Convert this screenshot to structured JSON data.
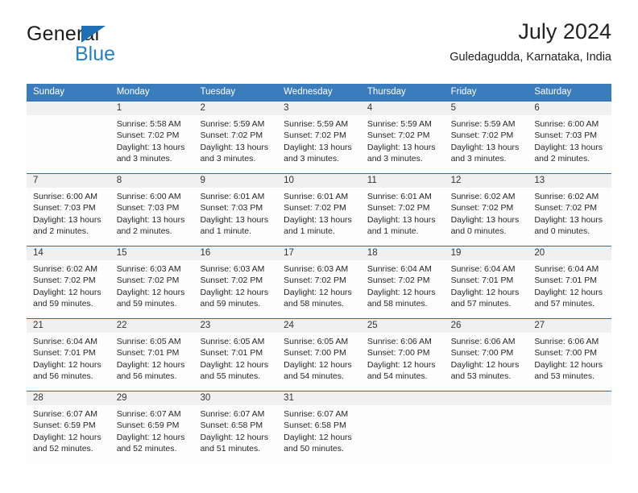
{
  "brand": {
    "name_top": "General",
    "name_bottom": "Blue",
    "accent_color": "#2581c4"
  },
  "header": {
    "title": "July 2024",
    "subtitle": "Guledagudda, Karnataka, India"
  },
  "theme": {
    "header_blue": "#3b7cbd",
    "row_rule_blue": "#2e6da4",
    "daynum_band": "#f0f0f0"
  },
  "weekdays": [
    "Sunday",
    "Monday",
    "Tuesday",
    "Wednesday",
    "Thursday",
    "Friday",
    "Saturday"
  ],
  "weeks": [
    [
      {
        "day": "",
        "sunrise": "",
        "sunset": "",
        "daylight1": "",
        "daylight2": ""
      },
      {
        "day": "1",
        "sunrise": "Sunrise: 5:58 AM",
        "sunset": "Sunset: 7:02 PM",
        "daylight1": "Daylight: 13 hours",
        "daylight2": "and 3 minutes."
      },
      {
        "day": "2",
        "sunrise": "Sunrise: 5:59 AM",
        "sunset": "Sunset: 7:02 PM",
        "daylight1": "Daylight: 13 hours",
        "daylight2": "and 3 minutes."
      },
      {
        "day": "3",
        "sunrise": "Sunrise: 5:59 AM",
        "sunset": "Sunset: 7:02 PM",
        "daylight1": "Daylight: 13 hours",
        "daylight2": "and 3 minutes."
      },
      {
        "day": "4",
        "sunrise": "Sunrise: 5:59 AM",
        "sunset": "Sunset: 7:02 PM",
        "daylight1": "Daylight: 13 hours",
        "daylight2": "and 3 minutes."
      },
      {
        "day": "5",
        "sunrise": "Sunrise: 5:59 AM",
        "sunset": "Sunset: 7:02 PM",
        "daylight1": "Daylight: 13 hours",
        "daylight2": "and 3 minutes."
      },
      {
        "day": "6",
        "sunrise": "Sunrise: 6:00 AM",
        "sunset": "Sunset: 7:03 PM",
        "daylight1": "Daylight: 13 hours",
        "daylight2": "and 2 minutes."
      }
    ],
    [
      {
        "day": "7",
        "sunrise": "Sunrise: 6:00 AM",
        "sunset": "Sunset: 7:03 PM",
        "daylight1": "Daylight: 13 hours",
        "daylight2": "and 2 minutes."
      },
      {
        "day": "8",
        "sunrise": "Sunrise: 6:00 AM",
        "sunset": "Sunset: 7:03 PM",
        "daylight1": "Daylight: 13 hours",
        "daylight2": "and 2 minutes."
      },
      {
        "day": "9",
        "sunrise": "Sunrise: 6:01 AM",
        "sunset": "Sunset: 7:03 PM",
        "daylight1": "Daylight: 13 hours",
        "daylight2": "and 1 minute."
      },
      {
        "day": "10",
        "sunrise": "Sunrise: 6:01 AM",
        "sunset": "Sunset: 7:02 PM",
        "daylight1": "Daylight: 13 hours",
        "daylight2": "and 1 minute."
      },
      {
        "day": "11",
        "sunrise": "Sunrise: 6:01 AM",
        "sunset": "Sunset: 7:02 PM",
        "daylight1": "Daylight: 13 hours",
        "daylight2": "and 1 minute."
      },
      {
        "day": "12",
        "sunrise": "Sunrise: 6:02 AM",
        "sunset": "Sunset: 7:02 PM",
        "daylight1": "Daylight: 13 hours",
        "daylight2": "and 0 minutes."
      },
      {
        "day": "13",
        "sunrise": "Sunrise: 6:02 AM",
        "sunset": "Sunset: 7:02 PM",
        "daylight1": "Daylight: 13 hours",
        "daylight2": "and 0 minutes."
      }
    ],
    [
      {
        "day": "14",
        "sunrise": "Sunrise: 6:02 AM",
        "sunset": "Sunset: 7:02 PM",
        "daylight1": "Daylight: 12 hours",
        "daylight2": "and 59 minutes."
      },
      {
        "day": "15",
        "sunrise": "Sunrise: 6:03 AM",
        "sunset": "Sunset: 7:02 PM",
        "daylight1": "Daylight: 12 hours",
        "daylight2": "and 59 minutes."
      },
      {
        "day": "16",
        "sunrise": "Sunrise: 6:03 AM",
        "sunset": "Sunset: 7:02 PM",
        "daylight1": "Daylight: 12 hours",
        "daylight2": "and 59 minutes."
      },
      {
        "day": "17",
        "sunrise": "Sunrise: 6:03 AM",
        "sunset": "Sunset: 7:02 PM",
        "daylight1": "Daylight: 12 hours",
        "daylight2": "and 58 minutes."
      },
      {
        "day": "18",
        "sunrise": "Sunrise: 6:04 AM",
        "sunset": "Sunset: 7:02 PM",
        "daylight1": "Daylight: 12 hours",
        "daylight2": "and 58 minutes."
      },
      {
        "day": "19",
        "sunrise": "Sunrise: 6:04 AM",
        "sunset": "Sunset: 7:01 PM",
        "daylight1": "Daylight: 12 hours",
        "daylight2": "and 57 minutes."
      },
      {
        "day": "20",
        "sunrise": "Sunrise: 6:04 AM",
        "sunset": "Sunset: 7:01 PM",
        "daylight1": "Daylight: 12 hours",
        "daylight2": "and 57 minutes."
      }
    ],
    [
      {
        "day": "21",
        "sunrise": "Sunrise: 6:04 AM",
        "sunset": "Sunset: 7:01 PM",
        "daylight1": "Daylight: 12 hours",
        "daylight2": "and 56 minutes."
      },
      {
        "day": "22",
        "sunrise": "Sunrise: 6:05 AM",
        "sunset": "Sunset: 7:01 PM",
        "daylight1": "Daylight: 12 hours",
        "daylight2": "and 56 minutes."
      },
      {
        "day": "23",
        "sunrise": "Sunrise: 6:05 AM",
        "sunset": "Sunset: 7:01 PM",
        "daylight1": "Daylight: 12 hours",
        "daylight2": "and 55 minutes."
      },
      {
        "day": "24",
        "sunrise": "Sunrise: 6:05 AM",
        "sunset": "Sunset: 7:00 PM",
        "daylight1": "Daylight: 12 hours",
        "daylight2": "and 54 minutes."
      },
      {
        "day": "25",
        "sunrise": "Sunrise: 6:06 AM",
        "sunset": "Sunset: 7:00 PM",
        "daylight1": "Daylight: 12 hours",
        "daylight2": "and 54 minutes."
      },
      {
        "day": "26",
        "sunrise": "Sunrise: 6:06 AM",
        "sunset": "Sunset: 7:00 PM",
        "daylight1": "Daylight: 12 hours",
        "daylight2": "and 53 minutes."
      },
      {
        "day": "27",
        "sunrise": "Sunrise: 6:06 AM",
        "sunset": "Sunset: 7:00 PM",
        "daylight1": "Daylight: 12 hours",
        "daylight2": "and 53 minutes."
      }
    ],
    [
      {
        "day": "28",
        "sunrise": "Sunrise: 6:07 AM",
        "sunset": "Sunset: 6:59 PM",
        "daylight1": "Daylight: 12 hours",
        "daylight2": "and 52 minutes."
      },
      {
        "day": "29",
        "sunrise": "Sunrise: 6:07 AM",
        "sunset": "Sunset: 6:59 PM",
        "daylight1": "Daylight: 12 hours",
        "daylight2": "and 52 minutes."
      },
      {
        "day": "30",
        "sunrise": "Sunrise: 6:07 AM",
        "sunset": "Sunset: 6:58 PM",
        "daylight1": "Daylight: 12 hours",
        "daylight2": "and 51 minutes."
      },
      {
        "day": "31",
        "sunrise": "Sunrise: 6:07 AM",
        "sunset": "Sunset: 6:58 PM",
        "daylight1": "Daylight: 12 hours",
        "daylight2": "and 50 minutes."
      },
      {
        "day": "",
        "sunrise": "",
        "sunset": "",
        "daylight1": "",
        "daylight2": ""
      },
      {
        "day": "",
        "sunrise": "",
        "sunset": "",
        "daylight1": "",
        "daylight2": ""
      },
      {
        "day": "",
        "sunrise": "",
        "sunset": "",
        "daylight1": "",
        "daylight2": ""
      }
    ]
  ]
}
